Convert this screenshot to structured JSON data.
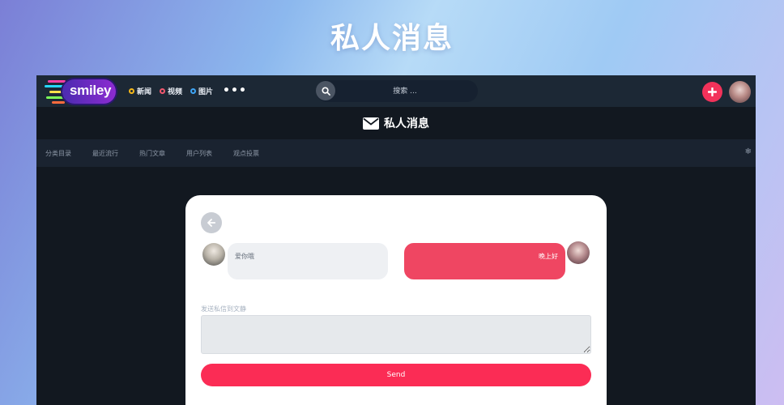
{
  "banner": {
    "title": "私人消息"
  },
  "topbar": {
    "logo_text": "smiley",
    "nav": [
      {
        "label": "新闻",
        "color": "#f5b819"
      },
      {
        "label": "视频",
        "color": "#f2586e"
      },
      {
        "label": "图片",
        "color": "#3ea4f4"
      }
    ],
    "more": "•••",
    "search_placeholder": "搜索 ..."
  },
  "page_header": {
    "title": "私人消息",
    "icon": "envelope-icon"
  },
  "subnav": {
    "items": [
      "分类目录",
      "最近流行",
      "热门文章",
      "用户列表",
      "观点投票"
    ],
    "icon": "gear-icon"
  },
  "conversation": {
    "messages": [
      {
        "side": "left",
        "text": "爱你哦"
      },
      {
        "side": "right",
        "text": "晚上好"
      }
    ],
    "compose_label": "发送私信到文静",
    "send_label": "Send"
  },
  "colors": {
    "accent": "#fb2c55",
    "outgoing_bubble": "#ef4662",
    "incoming_bubble": "#eef0f3",
    "topbar": "#1c2835",
    "page_bg": "#121820"
  }
}
